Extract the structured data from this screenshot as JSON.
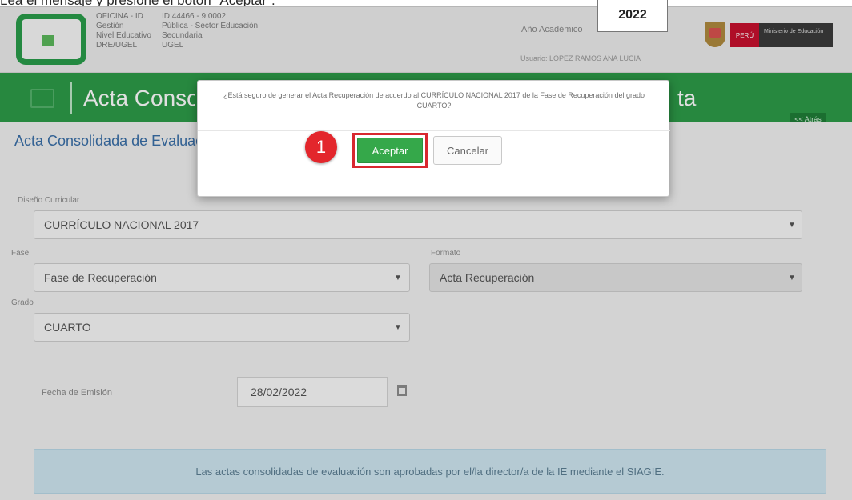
{
  "instruction": "Lea el mensaje y presione el botón \"Aceptar\".",
  "header": {
    "info_rows": [
      {
        "key": "OFICINA - ID",
        "value": "ID 44466 - 9 0002"
      },
      {
        "key": "Gestión",
        "value": "Pública - Sector Educación"
      },
      {
        "key": "Nivel Educativo",
        "value": "Secundaria"
      },
      {
        "key": "DRE/UGEL",
        "value": "UGEL"
      }
    ],
    "year_label": "Año Académico",
    "year": "2022",
    "usuario": "Usuario: LOPEZ RAMOS ANA LUCIA",
    "brand_peru": "PERÚ",
    "brand_ministry": "Ministerio de Educación"
  },
  "titlebar": {
    "title": "Acta Consolidada",
    "title_tail": "ta",
    "back_label": "<< Atrás"
  },
  "page": {
    "section_title": "Acta Consolidada de Evaluación",
    "diseno_label": "Diseño Curricular",
    "diseno_value": "CURRÍCULO NACIONAL 2017",
    "fase_label": "Fase",
    "fase_value": "Fase de Recuperación",
    "formato_label": "Formato",
    "formato_value": "Acta Recuperación",
    "grado_label": "Grado",
    "grado_value": "CUARTO",
    "fecha_label": "Fecha de Emisión",
    "fecha_value": "28/02/2022",
    "notice": "Las actas consolidadas de evaluación son aprobadas por el/la director/a de la IE mediante el SIAGIE."
  },
  "modal": {
    "message": "¿Está seguro de generar el Acta Recuperación de acuerdo al CURRÍCULO NACIONAL 2017 de la Fase de Recuperación del grado CUARTO?",
    "step_number": "1",
    "accept_label": "Aceptar",
    "cancel_label": "Cancelar"
  },
  "colors": {
    "brand_green": "#2d9b48",
    "accept_green": "#35a84a",
    "highlight_red": "#d9282f",
    "section_blue": "#3a6fa8"
  }
}
